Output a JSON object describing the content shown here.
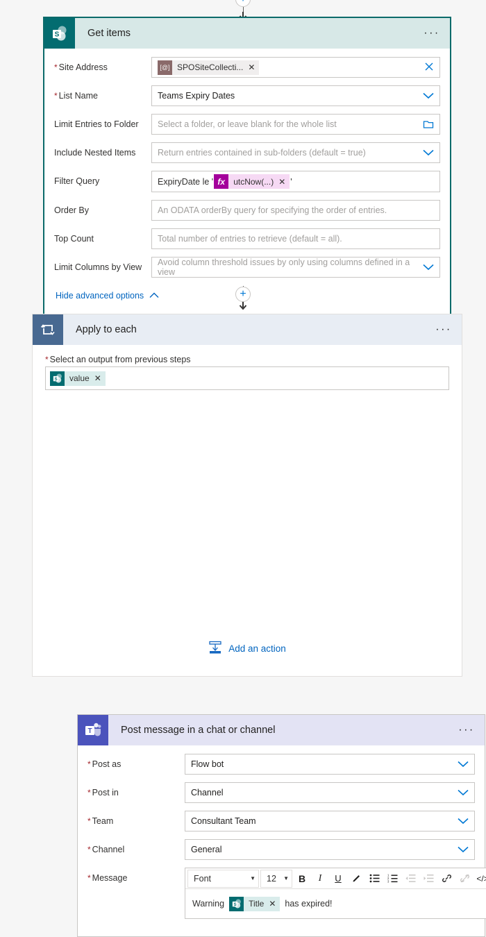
{
  "connectors": {
    "add_icon": "plus-icon",
    "arrow_icon": "arrow-down-icon"
  },
  "get_items": {
    "title": "Get items",
    "icon": "sharepoint-icon",
    "menu": "···",
    "accent": "#0b6a6a",
    "header_bg": "#d7e8e7",
    "fields": [
      {
        "label": "Site Address",
        "required": true,
        "type": "token",
        "token": {
          "text": "SPOSiteCollecti...",
          "icon": "at-sign-icon",
          "remove": "✕"
        },
        "trailing_icon": "clear-icon"
      },
      {
        "label": "List Name",
        "required": true,
        "type": "value",
        "value": "Teams Expiry Dates",
        "trailing_icon": "chevron-down-icon"
      },
      {
        "label": "Limit Entries to Folder",
        "required": false,
        "type": "placeholder",
        "placeholder": "Select a folder, or leave blank for the whole list",
        "trailing_icon": "folder-picker-icon"
      },
      {
        "label": "Include Nested Items",
        "required": false,
        "type": "placeholder",
        "placeholder": "Return entries contained in sub-folders (default = true)",
        "trailing_icon": "chevron-down-icon"
      },
      {
        "label": "Filter Query",
        "required": false,
        "type": "expression",
        "prefix": "ExpiryDate le '",
        "token": {
          "text": "utcNow(...)",
          "icon": "fx-icon",
          "remove": "✕"
        },
        "suffix": "'"
      },
      {
        "label": "Order By",
        "required": false,
        "type": "placeholder",
        "placeholder": "An ODATA orderBy query for specifying the order of entries."
      },
      {
        "label": "Top Count",
        "required": false,
        "type": "placeholder",
        "placeholder": "Total number of entries to retrieve (default = all)."
      },
      {
        "label": "Limit Columns by View",
        "required": false,
        "type": "placeholder",
        "placeholder": "Avoid column threshold issues by only using columns defined in a view",
        "trailing_icon": "chevron-down-icon"
      }
    ],
    "advanced_link": {
      "label": "Hide advanced options",
      "icon": "chevron-up-icon"
    }
  },
  "apply_to_each": {
    "title": "Apply to each",
    "icon": "loop-icon",
    "menu": "···",
    "header_bg": "#e8edf4",
    "output_label": "Select an output from previous steps",
    "output_required": true,
    "output_token": {
      "text": "value",
      "icon": "sharepoint-icon",
      "remove": "✕"
    },
    "add_action": {
      "label": "Add an action",
      "icon": "add-action-icon"
    }
  },
  "teams_action": {
    "title": "Post message in a chat or channel",
    "icon": "teams-icon",
    "menu": "···",
    "header_bg": "#e3e3f4",
    "fields": [
      {
        "label": "Post as",
        "required": true,
        "value": "Flow bot",
        "trailing_icon": "chevron-down-icon"
      },
      {
        "label": "Post in",
        "required": true,
        "value": "Channel",
        "trailing_icon": "chevron-down-icon"
      },
      {
        "label": "Team",
        "required": true,
        "value": "Consultant Team",
        "trailing_icon": "chevron-down-icon"
      },
      {
        "label": "Channel",
        "required": true,
        "value": "General",
        "trailing_icon": "chevron-down-icon"
      }
    ],
    "message": {
      "label": "Message",
      "required": true,
      "font_name": "Font",
      "font_size": "12",
      "toolbar": [
        {
          "name": "bold-icon",
          "glyph": "B",
          "disabled": false
        },
        {
          "name": "italic-icon",
          "glyph": "I",
          "disabled": false
        },
        {
          "name": "underline-icon",
          "glyph": "U",
          "disabled": false
        },
        {
          "name": "highlighter-icon",
          "glyph": "✎",
          "disabled": false
        },
        {
          "name": "bulleted-list-icon",
          "glyph": "",
          "disabled": false
        },
        {
          "name": "numbered-list-icon",
          "glyph": "",
          "disabled": false
        },
        {
          "name": "decrease-indent-icon",
          "glyph": "",
          "disabled": true
        },
        {
          "name": "increase-indent-icon",
          "glyph": "",
          "disabled": true
        },
        {
          "name": "link-icon",
          "glyph": "",
          "disabled": false
        },
        {
          "name": "unlink-icon",
          "glyph": "",
          "disabled": true
        },
        {
          "name": "code-view-icon",
          "glyph": "</>",
          "disabled": false
        }
      ],
      "body_prefix": "Warning",
      "body_token": {
        "text": "Title",
        "icon": "sharepoint-icon",
        "remove": "✕"
      },
      "body_suffix": "has expired!"
    }
  }
}
